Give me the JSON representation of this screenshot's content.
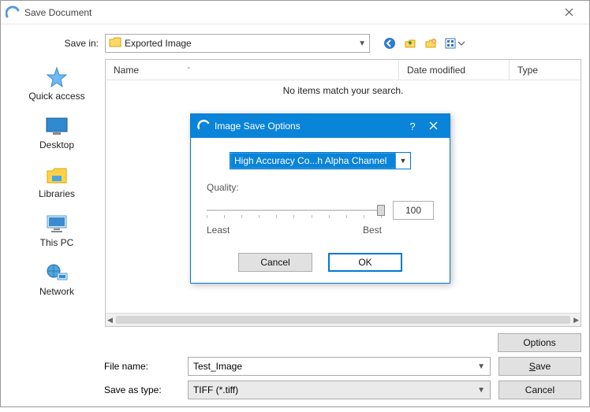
{
  "window": {
    "title": "Save Document"
  },
  "savein": {
    "label": "Save in:",
    "value": "Exported Image"
  },
  "sidebar": {
    "items": [
      {
        "label": "Quick access"
      },
      {
        "label": "Desktop"
      },
      {
        "label": "Libraries"
      },
      {
        "label": "This PC"
      },
      {
        "label": "Network"
      }
    ]
  },
  "columns": {
    "name": "Name",
    "date": "Date modified",
    "type": "Type"
  },
  "empty_text": "No items match your search.",
  "buttons": {
    "options": "Options",
    "save": "ave",
    "save_prefix": "S",
    "cancel": "Cancel"
  },
  "filename": {
    "label": "File name:",
    "value": "Test_Image"
  },
  "filetype": {
    "label": "Save as type:",
    "value": "TIFF (*.tiff)"
  },
  "modal": {
    "title": "Image Save Options",
    "compression_value": "High Accuracy Co...h Alpha Channel",
    "quality_label": "Quality:",
    "quality_value": "100",
    "least": "Least",
    "best": "Best",
    "cancel": "Cancel",
    "ok": "OK"
  }
}
